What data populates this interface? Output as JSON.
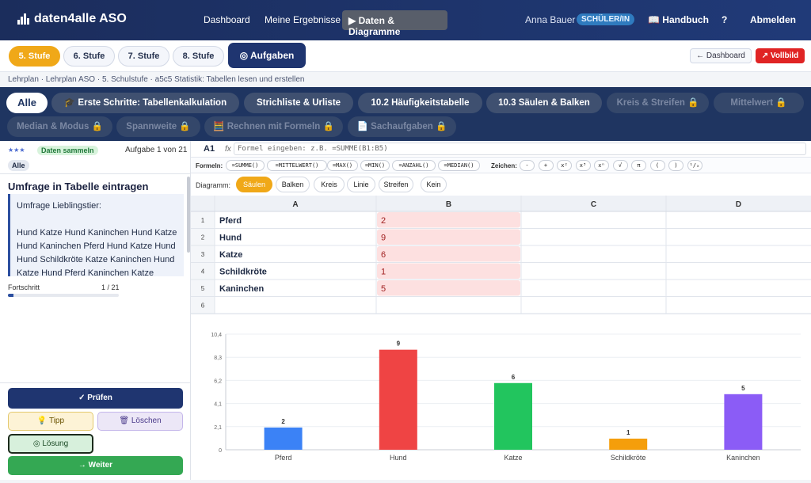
{
  "nav": {
    "logo": "daten4alle ASO",
    "links": [
      "Dashboard",
      "Meine Ergebnisse"
    ],
    "active": "▶ Daten & Diagramme",
    "user": "Anna Bauer",
    "role": "SCHÜLER/IN",
    "handbuch": "📖 Handbuch",
    "help": "?",
    "logout": "Abmelden"
  },
  "tiers": [
    "5. Stufe",
    "6. Stufe",
    "7. Stufe",
    "8. Stufe"
  ],
  "aufgaben": "◎ Aufgaben",
  "back_dashboard": "← Dashboard",
  "vollbild": "↗ Vollbild",
  "breadcrumb": "Lehrplan · Lehrplan ASO · 5. Schulstufe · a5c5 Statistik: Tabellen lesen und erstellen",
  "topics": [
    {
      "label": "Alle",
      "state": "active"
    },
    {
      "label": "🎓 Erste Schritte: Tabellenkalkulation",
      "state": "open"
    },
    {
      "label": "Strichliste & Urliste",
      "state": "open"
    },
    {
      "label": "10.2 Häufigkeitstabelle",
      "state": "open"
    },
    {
      "label": "10.3 Säulen & Balken",
      "state": "open"
    },
    {
      "label": "Kreis & Streifen 🔒",
      "state": "locked"
    },
    {
      "label": "Mittelwert 🔒",
      "state": "locked"
    },
    {
      "label": "Median & Modus 🔒",
      "state": "locked"
    },
    {
      "label": "Spannweite 🔒",
      "state": "locked"
    },
    {
      "label": "🧮 Rechnen mit Formeln 🔒",
      "state": "locked"
    },
    {
      "label": "📄 Sachaufgaben 🔒",
      "state": "locked"
    }
  ],
  "task": {
    "stars": "★★★",
    "badge": "Daten sammeln",
    "counter": "Aufgabe 1 von 21",
    "filter": "Alle",
    "title": "Umfrage in Tabelle eintragen",
    "prompt": "Umfrage Lieblingstier:",
    "text": "Hund Katze Hund Kaninchen Hund Katze Hund Kaninchen Pferd Hund Katze Hund Hund Schildkröte Katze Kaninchen Hund Katze Hund Pferd Kaninchen Katze",
    "progress_label": "Fortschritt",
    "progress_value": "1 / 21",
    "progress_fraction": 0.048
  },
  "actions": {
    "check": "✓ Prüfen",
    "hint": "💡 Tipp",
    "clear": "🗑 Löschen",
    "solution": "◎ Lösung",
    "next": "→ Weiter"
  },
  "formula_bar": {
    "cell": "A1",
    "fx": "fx",
    "placeholder": "Formel eingeben: z.B. =SUMME(B1:B5)"
  },
  "formulas_label": "Formeln:",
  "formulas": [
    "=SUMME()",
    "=MITTELWERT()",
    "=MAX()",
    "=MIN()",
    "=ANZAHL()",
    "=MEDIAN()"
  ],
  "symbols_label": "Zeichen:",
  "symbols": [
    "-",
    "+",
    "x²",
    "x³",
    "xⁿ",
    "√",
    "π",
    "(",
    ")",
    "¹/ₓ"
  ],
  "diagram_label": "Diagramm:",
  "diagram_types": [
    "Säulen",
    "Balken",
    "Kreis",
    "Linie",
    "Streifen",
    "Kein"
  ],
  "diagram_active": "Säulen",
  "sheet": {
    "columns": [
      "A",
      "B",
      "C",
      "D"
    ],
    "rows": [
      {
        "n": "1",
        "a": "Pferd",
        "b": "2"
      },
      {
        "n": "2",
        "a": "Hund",
        "b": "9"
      },
      {
        "n": "3",
        "a": "Katze",
        "b": "6"
      },
      {
        "n": "4",
        "a": "Schildkröte",
        "b": "1"
      },
      {
        "n": "5",
        "a": "Kaninchen",
        "b": "5"
      },
      {
        "n": "6",
        "a": "",
        "b": ""
      }
    ]
  },
  "colors": {
    "accent": "#f0a818",
    "navy": "#1f3570",
    "green": "#34a853",
    "red": "#e02424"
  },
  "chart_data": {
    "type": "bar",
    "categories": [
      "Pferd",
      "Hund",
      "Katze",
      "Schildkröte",
      "Kaninchen"
    ],
    "values": [
      2,
      9,
      6,
      1,
      5
    ],
    "colors": [
      "#3b82f6",
      "#ef4444",
      "#22c55e",
      "#f59e0b",
      "#8b5cf6"
    ],
    "yticks": [
      "0",
      "2,1",
      "4,1",
      "6,2",
      "8,3",
      "10,4"
    ],
    "ylim": [
      0,
      10.4
    ],
    "grid": true,
    "legend": "none"
  }
}
